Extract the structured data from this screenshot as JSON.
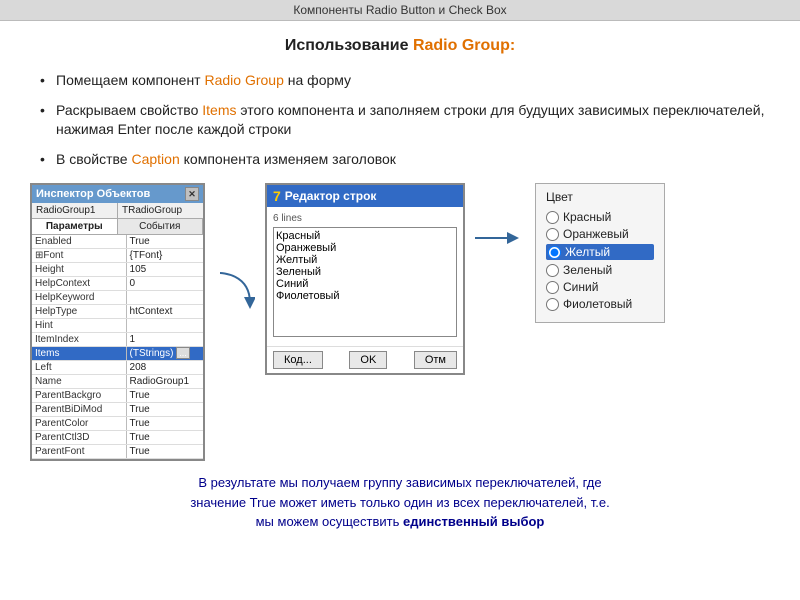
{
  "topBar": {
    "text": "Компоненты  Radio Button  и  Check Box"
  },
  "title": {
    "prefix": "Использование ",
    "highlight": "Radio Group:",
    "full": "Использование Radio Group:"
  },
  "bullets": [
    {
      "text_before": "Помещаем компонент ",
      "highlight": "Radio Group",
      "text_after": " на форму"
    },
    {
      "text_before": "Раскрываем свойство ",
      "highlight": "Items",
      "text_after": " этого компонента и заполняем строки для будущих зависимых переключателей, нажимая Enter после каждой строки"
    },
    {
      "text_before": "В свойстве ",
      "highlight": "Caption",
      "text_after": " компонента изменяем заголовок"
    }
  ],
  "inspector": {
    "title": "Инспектор Объектов",
    "component": "RadioGroup1",
    "type": "TRadioGroup",
    "tabs": [
      "Параметры",
      "События"
    ],
    "rows": [
      {
        "prop": "Enabled",
        "val": "True"
      },
      {
        "prop": "⊞Font",
        "val": "{TFont}"
      },
      {
        "prop": "Height",
        "val": "105"
      },
      {
        "prop": "HelpContext",
        "val": "0"
      },
      {
        "prop": "HelpKeyword",
        "val": ""
      },
      {
        "prop": "HelpType",
        "val": "htContext"
      },
      {
        "prop": "Hint",
        "val": ""
      },
      {
        "prop": "ItemIndex",
        "val": "1"
      },
      {
        "prop": "Items",
        "val": "(TStrings) ...",
        "highlighted": true
      },
      {
        "prop": "Left",
        "val": "208"
      },
      {
        "prop": "Name",
        "val": "RadioGroup1"
      },
      {
        "prop": "ParentBackgro",
        "val": "True"
      },
      {
        "prop": "ParentBiDiMod",
        "val": "True"
      },
      {
        "prop": "ParentColor",
        "val": "True"
      },
      {
        "prop": "ParentCtl3D",
        "val": "True"
      },
      {
        "prop": "ParentFont",
        "val": "True"
      }
    ]
  },
  "stringEditor": {
    "title": "Редактор строк",
    "linesLabel": "6 lines",
    "lines": [
      "Красный",
      "Оранжевый",
      "Желтый",
      "Зеленый",
      "Синий",
      "Фиолетовый"
    ],
    "buttons": {
      "code": "Код...",
      "ok": "OK",
      "cancel": "Отм"
    }
  },
  "colorGroup": {
    "title": "Цвет",
    "options": [
      {
        "label": "Красный",
        "selected": false
      },
      {
        "label": "Оранжевый",
        "selected": false
      },
      {
        "label": "Желтый",
        "selected": true
      },
      {
        "label": "Зеленый",
        "selected": false
      },
      {
        "label": "Синий",
        "selected": false
      },
      {
        "label": "Фиолетовый",
        "selected": false
      }
    ]
  },
  "bottomText": {
    "line1": "В результате мы получаем группу зависимых переключателей, где",
    "line2": "значение True может иметь только один из всех переключателей, т.е.",
    "line3_before": "мы можем осуществить ",
    "line3_bold": "единственный выбор"
  }
}
